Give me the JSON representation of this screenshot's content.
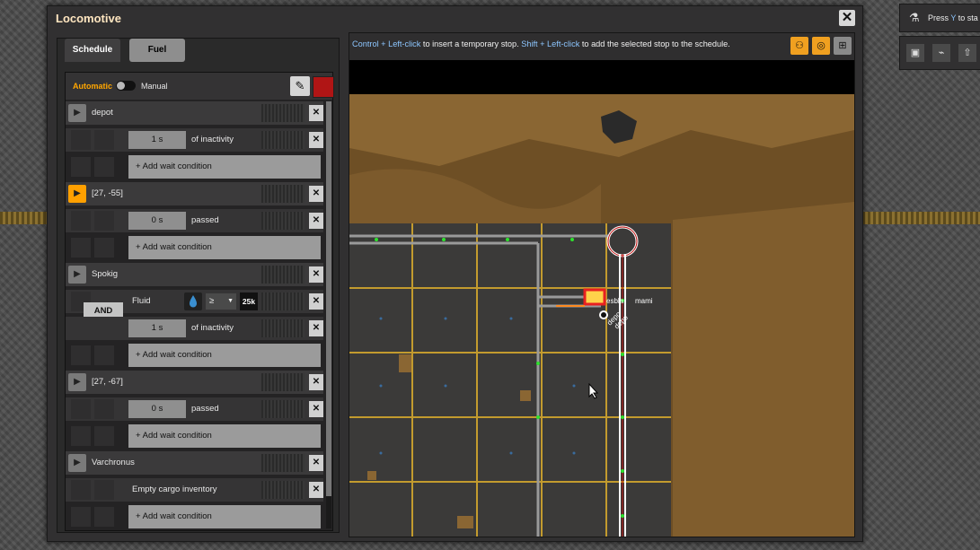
{
  "window": {
    "title": "Locomotive",
    "close_icon": "close-icon"
  },
  "tabs": [
    {
      "label": "Schedule",
      "active": true
    },
    {
      "label": "Fuel",
      "active": false
    }
  ],
  "mode": {
    "automatic_label": "Automatic",
    "manual_label": "Manual"
  },
  "colors": {
    "accent": "#ffa600",
    "train_color": "#b01515",
    "hint_key": "#8dc6ff"
  },
  "schedule": {
    "stops": [
      {
        "name": "depot",
        "active": false,
        "conditions": [
          {
            "value": "1 s",
            "text": "of inactivity"
          }
        ],
        "add_label": "+ Add wait condition"
      },
      {
        "name": "[27, -55]",
        "active": true,
        "conditions": [
          {
            "value": "0 s",
            "text": "passed"
          }
        ],
        "add_label": "+ Add wait condition"
      },
      {
        "name": "Spokig",
        "active": false,
        "and_label": "AND",
        "fluid_condition": {
          "label": "Fluid",
          "comparator": "≥",
          "amount": "25k"
        },
        "conditions": [
          {
            "value": "1 s",
            "text": "of inactivity"
          }
        ],
        "add_label": "+ Add wait condition"
      },
      {
        "name": "[27, -67]",
        "active": false,
        "conditions": [
          {
            "value": "0 s",
            "text": "passed"
          }
        ],
        "add_label": "+ Add wait condition"
      },
      {
        "name": "Varchronus",
        "active": false,
        "conditions": [
          {
            "text": "Empty cargo inventory"
          }
        ],
        "add_label": "+ Add wait condition"
      }
    ]
  },
  "map_hint": {
    "key1": "Control + Left-click",
    "text1": " to insert a temporary stop. ",
    "key2": "Shift + Left-click",
    "text2": " to add the selected stop to the schedule."
  },
  "map_labels": {
    "station_a": "depo",
    "station_b": "depo",
    "station_c": "esbla",
    "station_d": "mami"
  },
  "topright": {
    "hint_prefix": "Press ",
    "hint_key": "Y",
    "hint_suffix": " to sta"
  }
}
